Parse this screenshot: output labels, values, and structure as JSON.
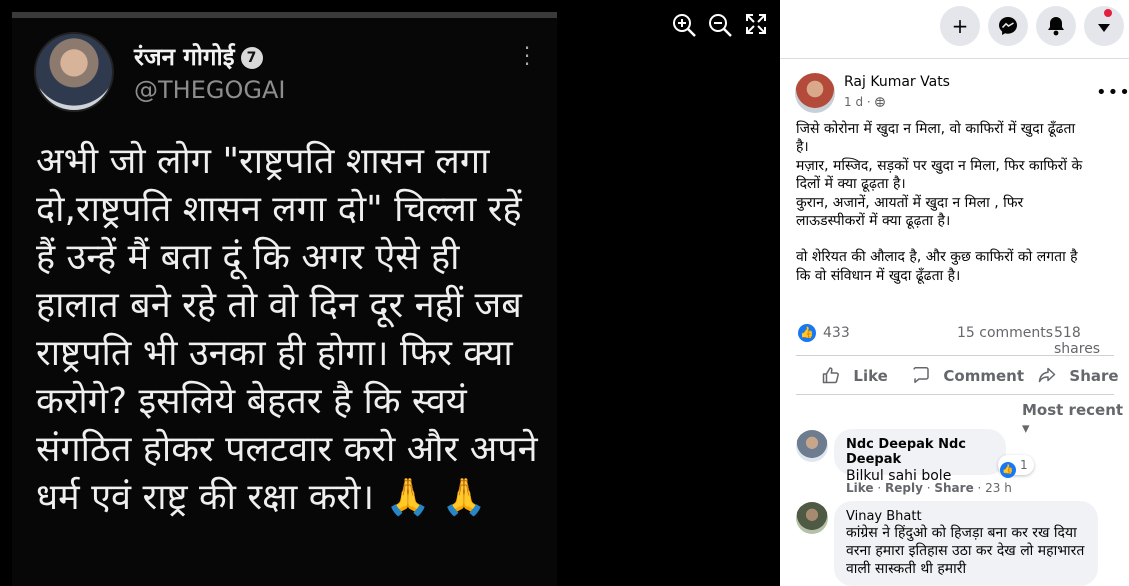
{
  "viewer": {
    "zoom_in_icon": "zoom-in-icon",
    "zoom_out_icon": "zoom-out-icon",
    "fullscreen_icon": "fullscreen-icon"
  },
  "tweet_image": {
    "name": "रंजन गोगोई",
    "badge": "7",
    "handle": "@THEGOGAI",
    "body": "अभी जो लोग \"राष्ट्रपति शासन लगा दो,राष्ट्रपति शासन लगा दो\" चिल्ला रहें हैं उन्हें मैं बता दूं कि अगर ऐसे ही हालात बने रहे तो वो दिन दूर नहीं जब राष्ट्रपति भी उनका ही होगा। फिर क्या करोगे? इसलिये बेहतर है कि स्वयं संगठित होकर पलटवार करो और अपने धर्म एवं राष्ट्र की रक्षा करो। 🙏 🙏"
  },
  "topnav": {
    "create_icon": "plus-icon",
    "messenger_icon": "messenger-icon",
    "notifications_icon": "bell-icon",
    "account_icon": "caret-down-icon"
  },
  "post": {
    "author": "Raj Kumar Vats",
    "time": "1 d",
    "privacy_icon": "globe-icon",
    "lines_p1": [
      "जिसे कोरोना में खुदा न मिला, वो काफिरों में खुदा ढूँढता",
      "है।",
      "मज़ार, मस्जिद, सड़कों पर खुदा न मिला, फिर काफिरों के",
      "दिलों में क्या ढूढ़ता है।",
      "कुरान, अजानें, आयतों में खुदा न मिला , फिर",
      "लाऊडस्पीकरों में क्या ढूढ़ता है।"
    ],
    "lines_p2": [
      "वो शेरियत की औलाद है, और कुछ काफिरों को लगता है",
      "कि वो संविधान में खुदा ढूँढता है।"
    ],
    "likes": "433",
    "comments": "15 comments",
    "shares": "518 shares"
  },
  "actions": {
    "like": "Like",
    "comment": "Comment",
    "share": "Share"
  },
  "sort": "Most recent",
  "comments": [
    {
      "name": "Ndc Deepak Ndc Deepak",
      "text": "Bilkul sahi bole",
      "reactions": "1",
      "like": "Like",
      "reply": "Reply",
      "share": "Share",
      "time": "23 h"
    },
    {
      "name": "Vinay Bhatt",
      "text": "कांग्रेस ने हिंदुओ को हिजड़ा बना कर रख दिया वरना हमारा इतिहास उठा कर देख लो महाभारत वाली सास्कती थी हमारी"
    }
  ]
}
